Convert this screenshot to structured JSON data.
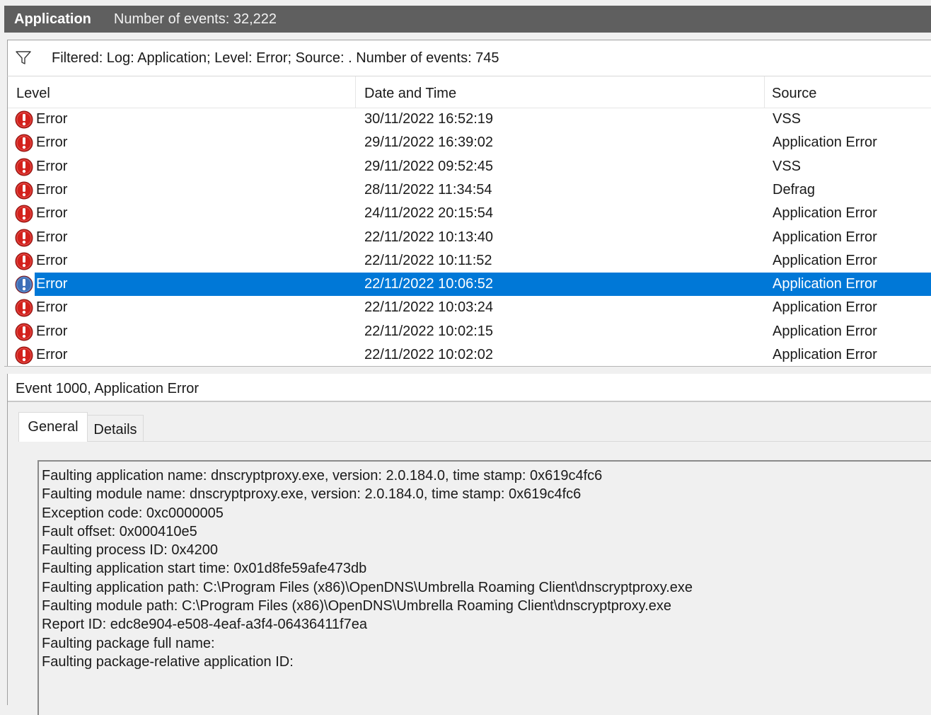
{
  "titlebar": {
    "log_name": "Application",
    "event_count": "Number of events: 32,222"
  },
  "filterbar": {
    "icon": "funnel-icon",
    "text": "Filtered: Log: Application; Level: Error; Source: . Number of events: 745"
  },
  "table": {
    "columns": [
      "Level",
      "Date and Time",
      "Source"
    ],
    "rows": [
      {
        "level": "Error",
        "date": "30/11/2022 16:52:19",
        "source": "VSS"
      },
      {
        "level": "Error",
        "date": "29/11/2022 16:39:02",
        "source": "Application Error"
      },
      {
        "level": "Error",
        "date": "29/11/2022 09:52:45",
        "source": "VSS"
      },
      {
        "level": "Error",
        "date": "28/11/2022 11:34:54",
        "source": "Defrag"
      },
      {
        "level": "Error",
        "date": "24/11/2022 20:15:54",
        "source": "Application Error"
      },
      {
        "level": "Error",
        "date": "22/11/2022 10:13:40",
        "source": "Application Error"
      },
      {
        "level": "Error",
        "date": "22/11/2022 10:11:52",
        "source": "Application Error"
      },
      {
        "level": "Error",
        "date": "22/11/2022 10:06:52",
        "source": "Application Error"
      },
      {
        "level": "Error",
        "date": "22/11/2022 10:03:24",
        "source": "Application Error"
      },
      {
        "level": "Error",
        "date": "22/11/2022 10:02:15",
        "source": "Application Error"
      },
      {
        "level": "Error",
        "date": "22/11/2022 10:02:02",
        "source": "Application Error"
      }
    ],
    "selected_index": 7,
    "icon": "error-icon"
  },
  "detail": {
    "title": "Event 1000, Application Error",
    "tabs": [
      "General",
      "Details"
    ],
    "active_tab": "General",
    "description": [
      "Faulting application name: dnscryptproxy.exe, version: 2.0.184.0, time stamp: 0x619c4fc6",
      "Faulting module name: dnscryptproxy.exe, version: 2.0.184.0, time stamp: 0x619c4fc6",
      "Exception code: 0xc0000005",
      "Fault offset: 0x000410e5",
      "Faulting process ID: 0x4200",
      "Faulting application start time: 0x01d8fe59afe473db",
      "Faulting application path: C:\\Program Files (x86)\\OpenDNS\\Umbrella Roaming Client\\dnscryptproxy.exe",
      "Faulting module path: C:\\Program Files (x86)\\OpenDNS\\Umbrella Roaming Client\\dnscryptproxy.exe",
      "Report ID: edc8e904-e508-4eaf-a3f4-06436411f7ea",
      "Faulting package full name: ",
      "Faulting package-relative application ID: "
    ]
  },
  "colors": {
    "titlebar_bg": "#5f5f5f",
    "selection": "#0078d7",
    "error_red": "#d3211c"
  }
}
